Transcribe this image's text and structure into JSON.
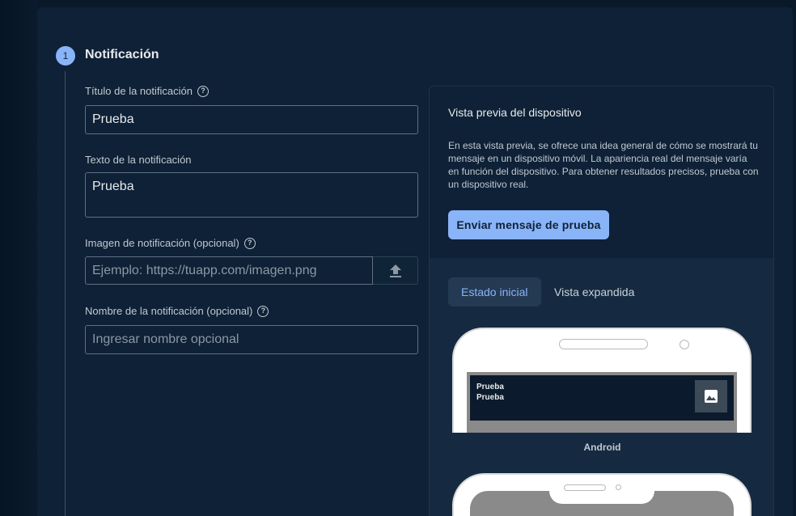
{
  "step": {
    "number": "1",
    "title": "Notificación"
  },
  "form": {
    "title_label": "Título de la notificación",
    "title_value": "Prueba",
    "text_label": "Texto de la notificación",
    "text_value": "Prueba",
    "image_label": "Imagen de notificación (opcional)",
    "image_placeholder": "Ejemplo: https://tuapp.com/imagen.png",
    "name_label": "Nombre de la notificación (opcional)",
    "name_placeholder": "Ingresar nombre opcional"
  },
  "preview": {
    "title": "Vista previa del dispositivo",
    "description": "En esta vista previa, se ofrece una idea general de cómo se mostrará tu mensaje en un dispositivo móvil. La apariencia real del mensaje varía en función del dispositivo. Para obtener resultados precisos, prueba con un dispositivo real.",
    "send_button": "Enviar mensaje de prueba",
    "tabs": [
      {
        "label": "Estado inicial",
        "active": true
      },
      {
        "label": "Vista expandida",
        "active": false
      }
    ],
    "notification_title": "Prueba",
    "notification_text": "Prueba",
    "device_label": "Android"
  },
  "icons": {
    "help": "help-circle-icon",
    "upload": "upload-icon",
    "image": "image-icon"
  },
  "colors": {
    "accent": "#8ab4f8",
    "background": "#0e2136"
  }
}
